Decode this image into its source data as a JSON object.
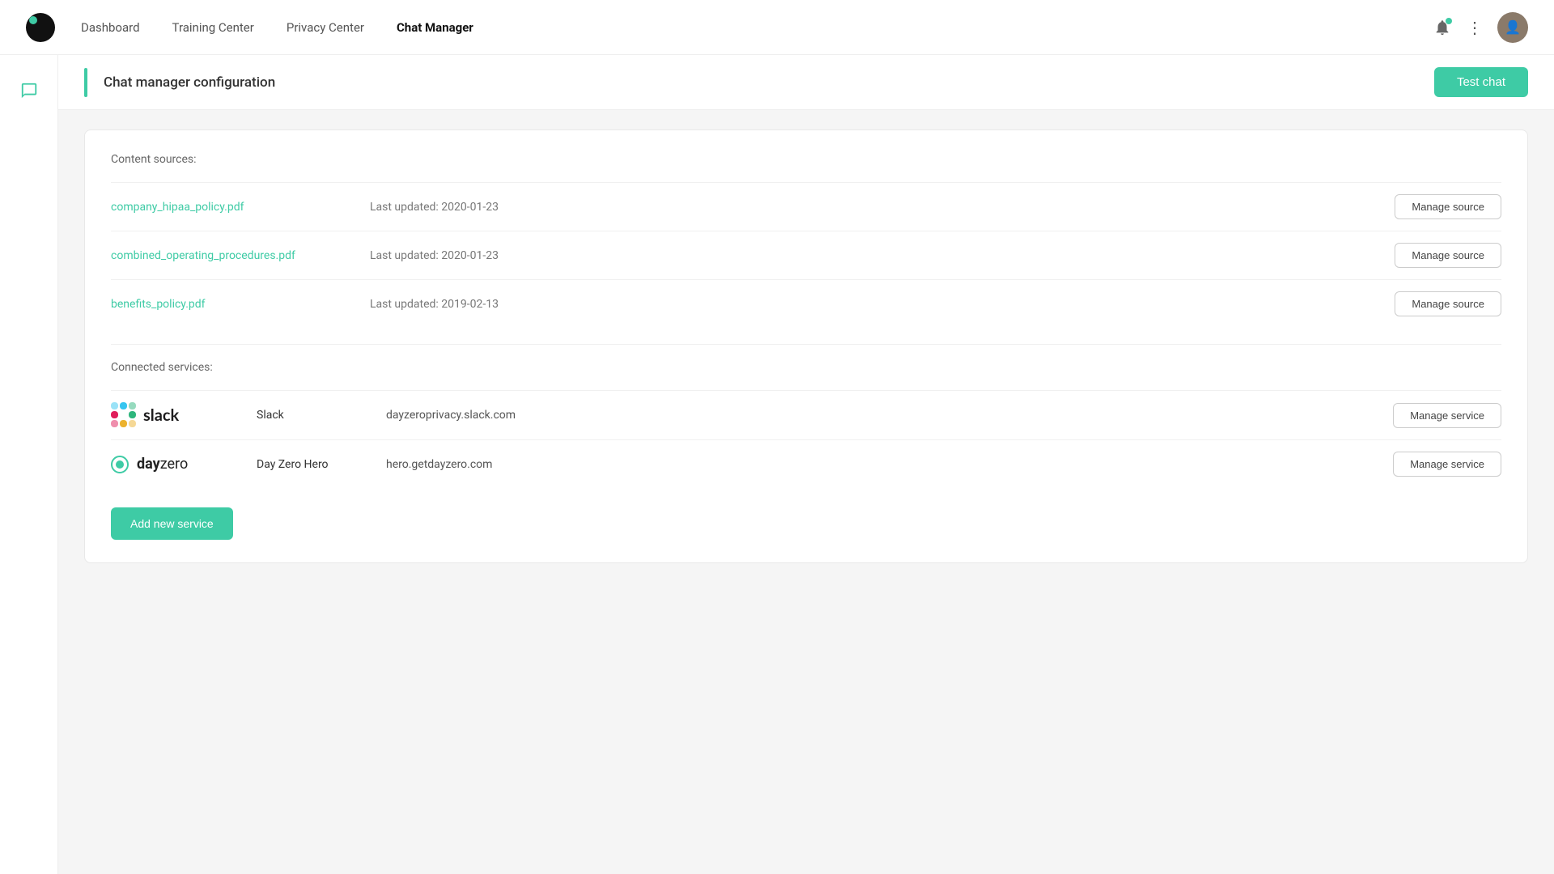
{
  "navbar": {
    "links": [
      {
        "label": "Dashboard",
        "active": false
      },
      {
        "label": "Training Center",
        "active": false
      },
      {
        "label": "Privacy Center",
        "active": false
      },
      {
        "label": "Chat Manager",
        "active": true
      }
    ]
  },
  "page": {
    "title": "Chat manager configuration",
    "test_chat_label": "Test chat"
  },
  "content_sources": {
    "section_label": "Content sources:",
    "sources": [
      {
        "name": "company_hipaa_policy.pdf",
        "last_updated": "Last updated: 2020-01-23"
      },
      {
        "name": "combined_operating_procedures.pdf",
        "last_updated": "Last updated: 2020-01-23"
      },
      {
        "name": "benefits_policy.pdf",
        "last_updated": "Last updated: 2019-02-13"
      }
    ],
    "manage_source_label": "Manage source"
  },
  "connected_services": {
    "section_label": "Connected services:",
    "services": [
      {
        "name": "Slack",
        "url": "dayzeroprivacy.slack.com"
      },
      {
        "name": "Day Zero Hero",
        "url": "hero.getdayzero.com"
      }
    ],
    "manage_service_label": "Manage service"
  },
  "add_service_label": "Add new service"
}
